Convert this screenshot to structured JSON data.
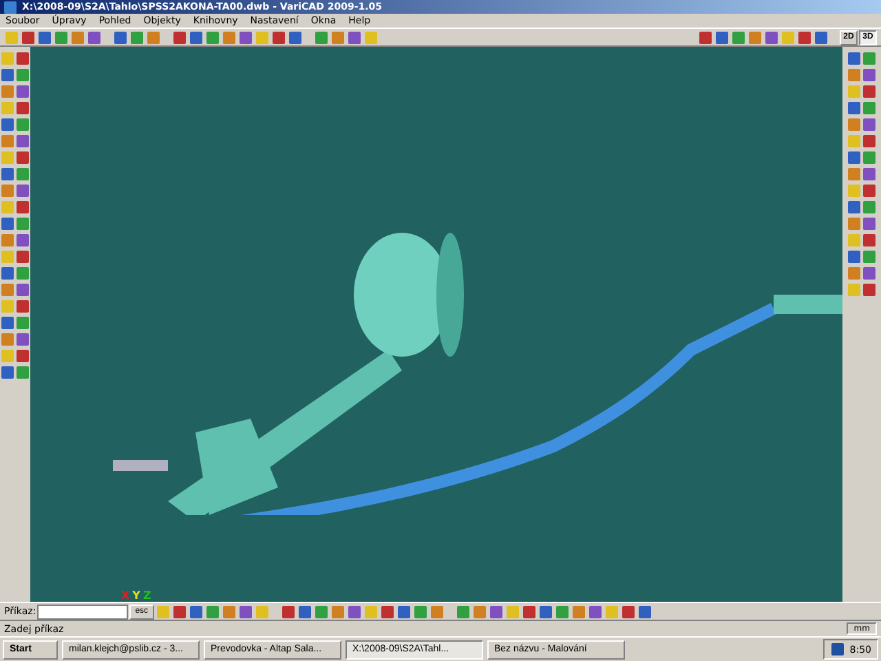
{
  "window": {
    "title": "X:\\2008-09\\S2A\\Tahlo\\SPSS2AKONA-TA00.dwb - VariCAD 2009-1.05"
  },
  "menu": [
    "Soubor",
    "Úpravy",
    "Pohled",
    "Objekty",
    "Knihovny",
    "Nastavení",
    "Okna",
    "Help"
  ],
  "view_buttons": [
    {
      "label": "2D",
      "selected": false
    },
    {
      "label": "3D",
      "selected": true
    }
  ],
  "axes": [
    {
      "label": "X",
      "color": "#e02020"
    },
    {
      "label": "Y",
      "color": "#e0e020"
    },
    {
      "label": "Z",
      "color": "#20c020"
    }
  ],
  "command": {
    "label": "Příkaz:",
    "esc": "esc"
  },
  "status_bar": {
    "prompt": "Zadej příkaz",
    "units": "mm"
  },
  "taskbar": {
    "start": "Start",
    "items": [
      {
        "label": "milan.klejch@pslib.cz - 3...",
        "selected": false
      },
      {
        "label": "Prevodovka - Altap Sala...",
        "selected": false
      },
      {
        "label": "X:\\2008-09\\S2A\\Tahl...",
        "selected": true
      },
      {
        "label": "Bez názvu - Malování",
        "selected": false
      }
    ],
    "clock": "8:50"
  }
}
